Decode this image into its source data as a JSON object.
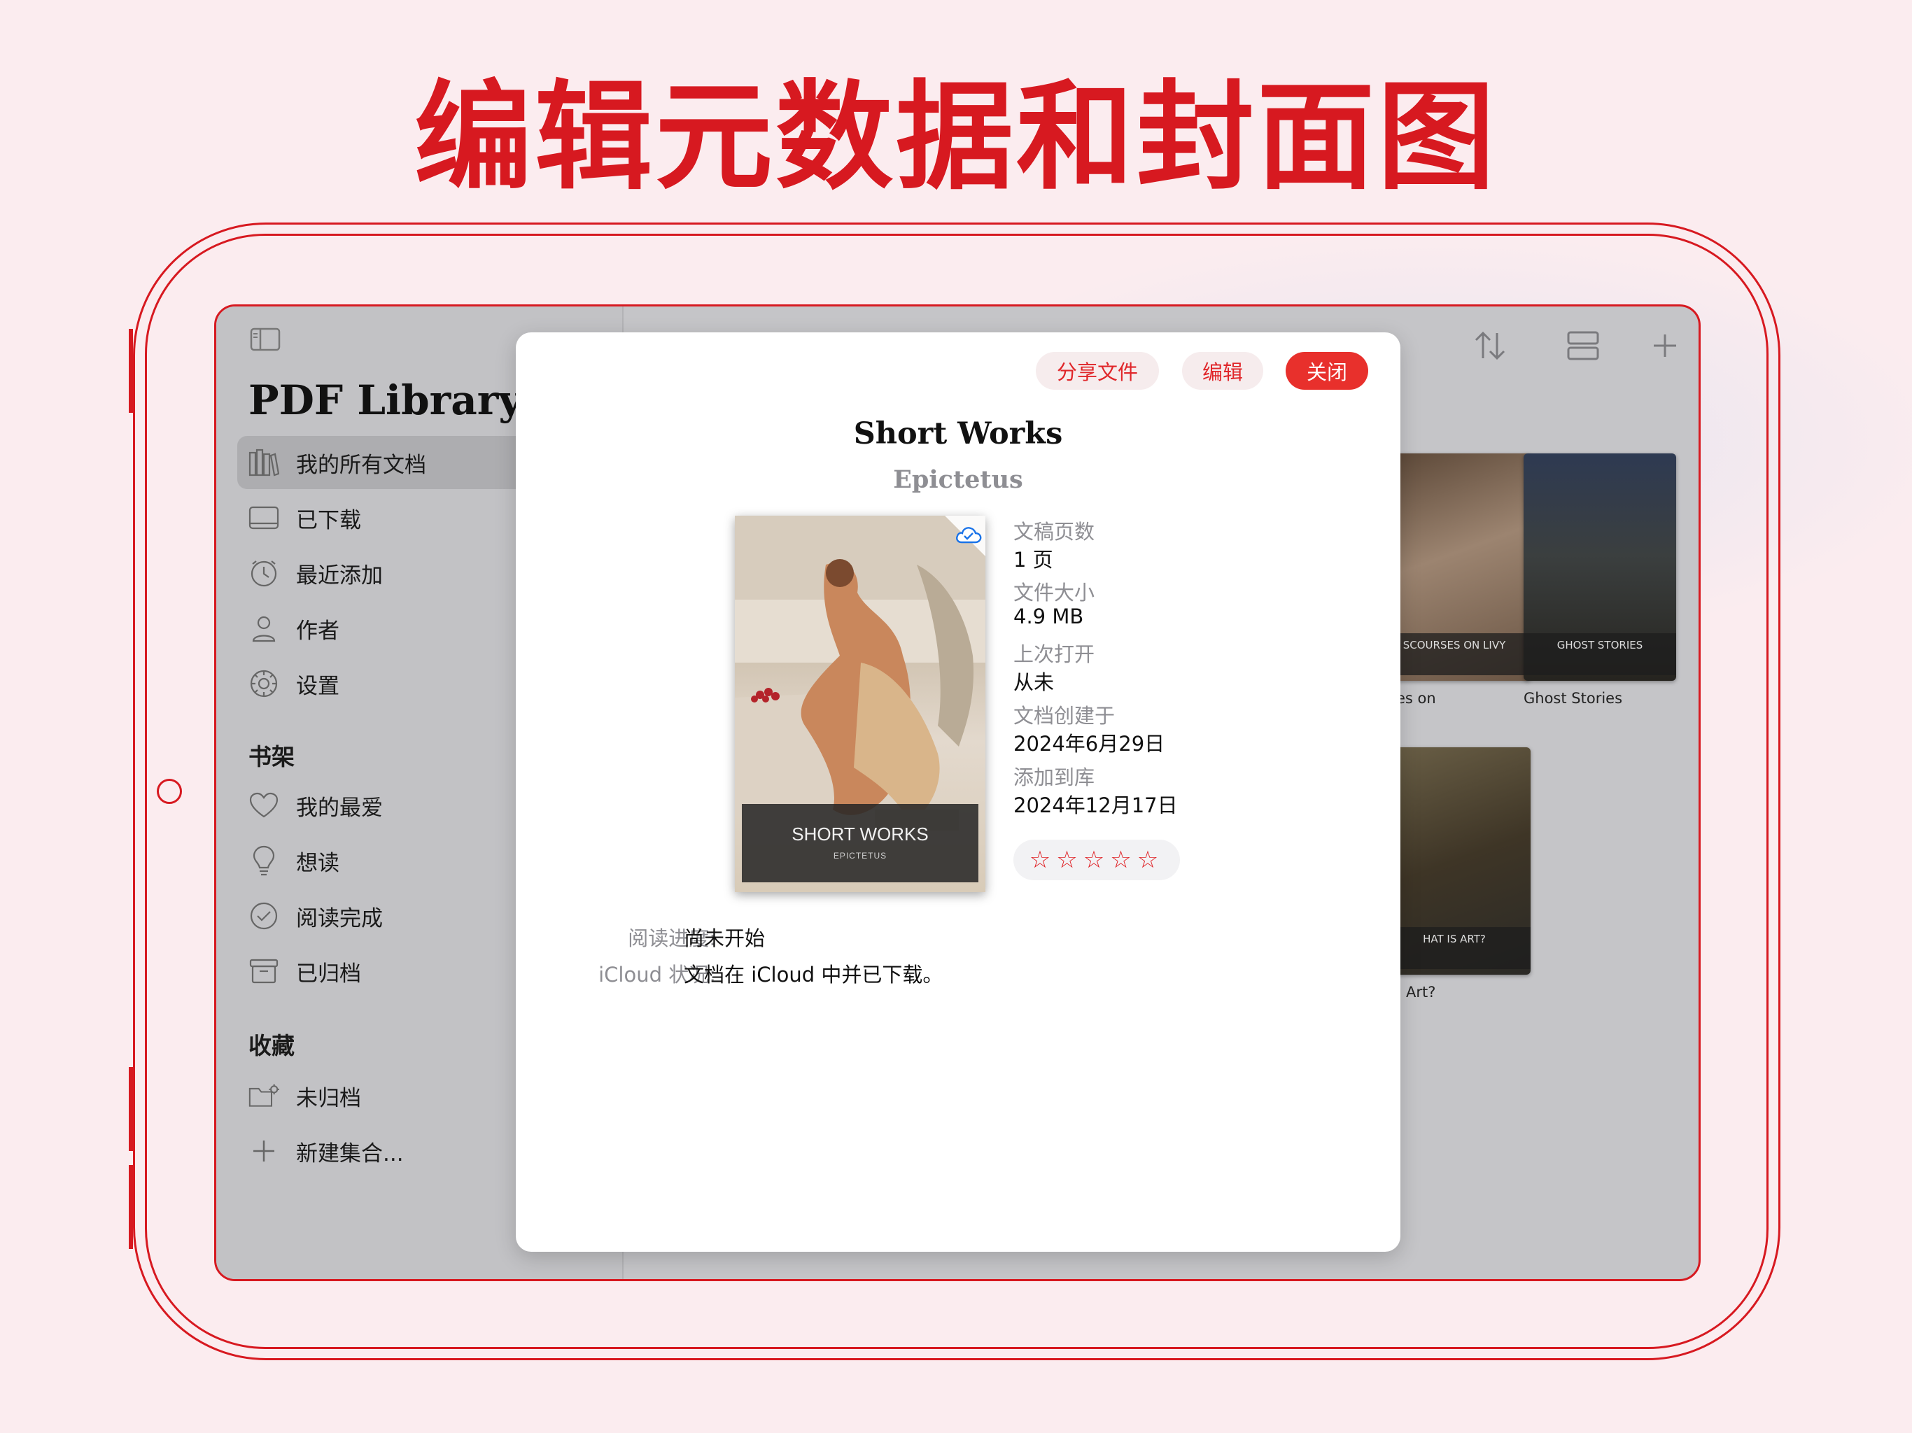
{
  "headline": "编辑元数据和封面图",
  "colors": {
    "brand_red": "#d71920",
    "accent_red": "#e8302c",
    "sidebar_bg": "#c2c2c5",
    "modal_bg": "#ffffff"
  },
  "sidebar": {
    "app_title": "PDF Library",
    "library_items": [
      {
        "label": "我的所有文档",
        "icon": "library-books-icon",
        "active": true
      },
      {
        "label": "已下载",
        "icon": "downloaded-tray-icon"
      },
      {
        "label": "最近添加",
        "icon": "clock-icon"
      },
      {
        "label": "作者",
        "icon": "person-icon"
      },
      {
        "label": "设置",
        "icon": "gear-icon"
      }
    ],
    "shelf_title": "书架",
    "shelf_items": [
      {
        "label": "我的最爱",
        "icon": "heart-icon"
      },
      {
        "label": "想读",
        "icon": "lightbulb-icon"
      },
      {
        "label": "阅读完成",
        "icon": "checkmark-circle-icon"
      },
      {
        "label": "已归档",
        "icon": "archive-box-icon"
      }
    ],
    "collections_title": "收藏",
    "collection_items": [
      {
        "label": "未归档",
        "icon": "folder-gear-icon"
      },
      {
        "label": "新建集合...",
        "icon": "plus-icon"
      }
    ]
  },
  "toolbar": {
    "icons": [
      "sort-arrows-icon",
      "layout-rows-icon",
      "add-icon"
    ]
  },
  "background_books": [
    {
      "caption": "ses on",
      "cover_text": "SCOURSES ON LIVY"
    },
    {
      "caption": "Ghost Stories",
      "cover_text": "GHOST STORIES"
    },
    {
      "caption": "Art?",
      "cover_text": "HAT IS ART?"
    }
  ],
  "modal": {
    "share_label": "分享文件",
    "edit_label": "编辑",
    "close_label": "关闭",
    "title": "Short Works",
    "author": "Epictetus",
    "cover": {
      "title": "SHORT WORKS",
      "subtitle": "EPICTETUS",
      "badge_icon": "icloud-check-icon"
    },
    "meta": [
      {
        "label": "文稿页数",
        "value": "1 页"
      },
      {
        "label": "文件大小",
        "value": "4.9 MB"
      },
      {
        "label": "上次打开",
        "value": "从未"
      },
      {
        "label": "文档创建于",
        "value": "2024年6月29日"
      },
      {
        "label": "添加到库",
        "value": "2024年12月17日"
      }
    ],
    "rating": {
      "value": 0,
      "max": 5,
      "display": "☆☆☆☆☆"
    },
    "reading_progress_label": "阅读进度:",
    "reading_progress_value": "尚未开始",
    "icloud_label": "iCloud 状况:",
    "icloud_value": "文档在 iCloud 中并已下载。"
  }
}
